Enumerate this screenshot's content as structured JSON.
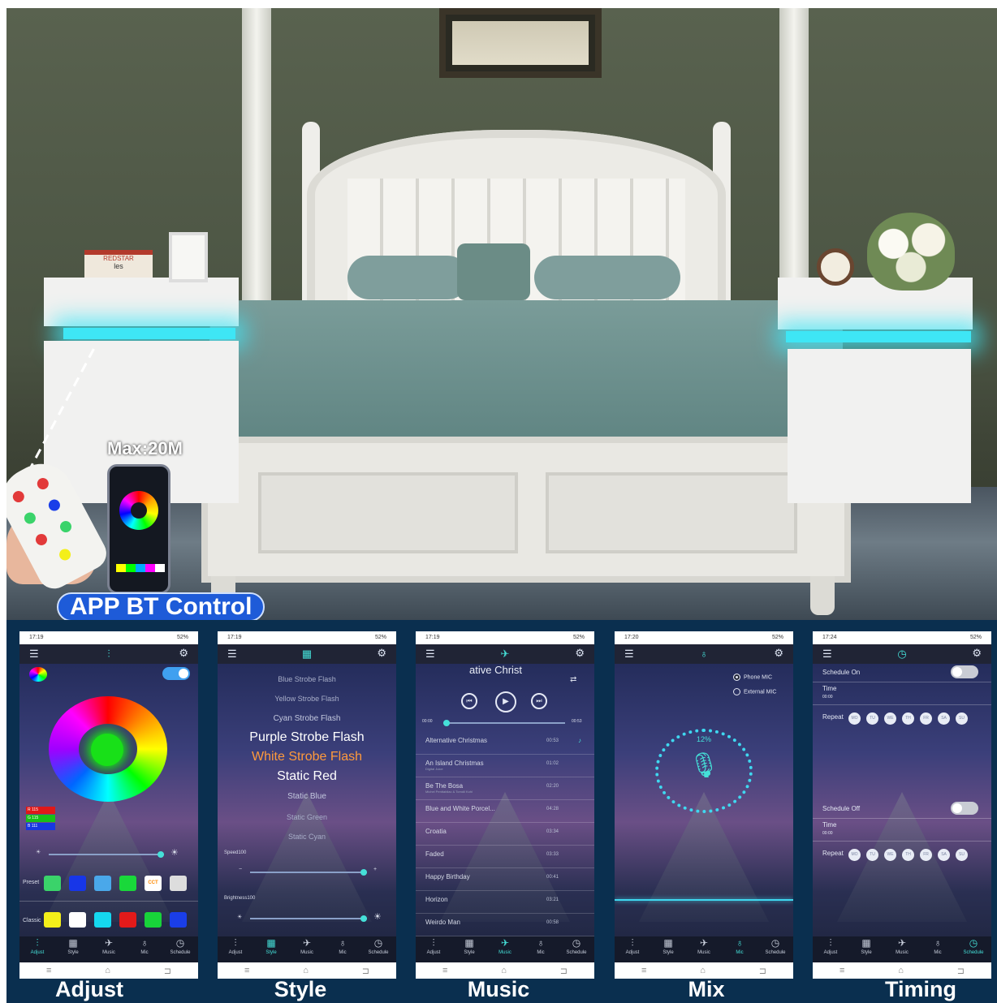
{
  "hero": {
    "book_label_1": "REDSTAR",
    "book_label_2": "les",
    "max_label": "Max:20M",
    "app_badge": "APP BT Control"
  },
  "common": {
    "statusbar_right": "52%",
    "menu_icon": "☰",
    "gear_icon": "⚙",
    "nav": [
      {
        "icon": "⫶",
        "label": "Adjust"
      },
      {
        "icon": "▦",
        "label": "Style"
      },
      {
        "icon": "✈",
        "label": "Music"
      },
      {
        "icon": "♁",
        "label": "Mic"
      },
      {
        "icon": "◷",
        "label": "Schedule"
      }
    ],
    "sys": [
      "≡",
      "⌂",
      "⊐"
    ]
  },
  "adjust": {
    "time": "17:19",
    "r": "R 115",
    "g": "G 115",
    "b": "B 111",
    "preset_label": "Preset",
    "classic_label": "Classic",
    "cct_label": "CCT",
    "preset_colors": [
      "#3ad36a",
      "#1736e8",
      "#4aa8ea",
      "#19d83a",
      "#ffffff",
      "#dddddd"
    ],
    "classic_colors": [
      "#f3ef1a",
      "#ffffff",
      "#15d8f0",
      "#e31a1a",
      "#18d33a",
      "#1a3ee8"
    ],
    "caption": "Adjust"
  },
  "style": {
    "time": "17:19",
    "items": [
      "Blue Strobe Flash",
      "Yellow Strobe Flash",
      "Cyan Strobe Flash",
      "Purple Strobe Flash",
      "White Strobe Flash",
      "Static Red",
      "Static Blue",
      "Static Green",
      "Static Cyan"
    ],
    "speed_label": "Speed100",
    "brightness_label": "Brightness100",
    "caption": "Style"
  },
  "music": {
    "time": "17:19",
    "now_playing": "ative Christ",
    "elapsed": "00:00",
    "total": "00:53",
    "songs": [
      {
        "title": "Alternative Christmas",
        "sub": "",
        "dur": "00:53"
      },
      {
        "title": "An Island Christmas",
        "sub": "Digital Juice",
        "dur": "01:02"
      },
      {
        "title": "Be The Bosa",
        "sub": "Michel Penttabliac & Tomdil Kohl",
        "dur": "02:20"
      },
      {
        "title": "Blue and White Porcel...",
        "sub": "",
        "dur": "04:28"
      },
      {
        "title": "Croatia",
        "sub": "",
        "dur": "03:34"
      },
      {
        "title": "Faded",
        "sub": "",
        "dur": "03:33"
      },
      {
        "title": "Happy Birthday",
        "sub": "",
        "dur": "00:41"
      },
      {
        "title": "Horizon",
        "sub": "",
        "dur": "03:21"
      },
      {
        "title": "Weirdo Man",
        "sub": "",
        "dur": "00:58"
      }
    ],
    "caption": "Music"
  },
  "mix": {
    "time": "17:20",
    "phone_mic": "Phone MIC",
    "external_mic": "External MIC",
    "percent": "12%",
    "caption": "Mix"
  },
  "timing": {
    "time": "17:24",
    "schedule_on": "Schedule On",
    "schedule_off": "Schedule Off",
    "time_label": "Time",
    "time_value": "00:00",
    "repeat_label": "Repeat",
    "days": [
      "MO",
      "TU",
      "WE",
      "TH",
      "FR",
      "SA",
      "SU"
    ],
    "caption": "Timing"
  }
}
